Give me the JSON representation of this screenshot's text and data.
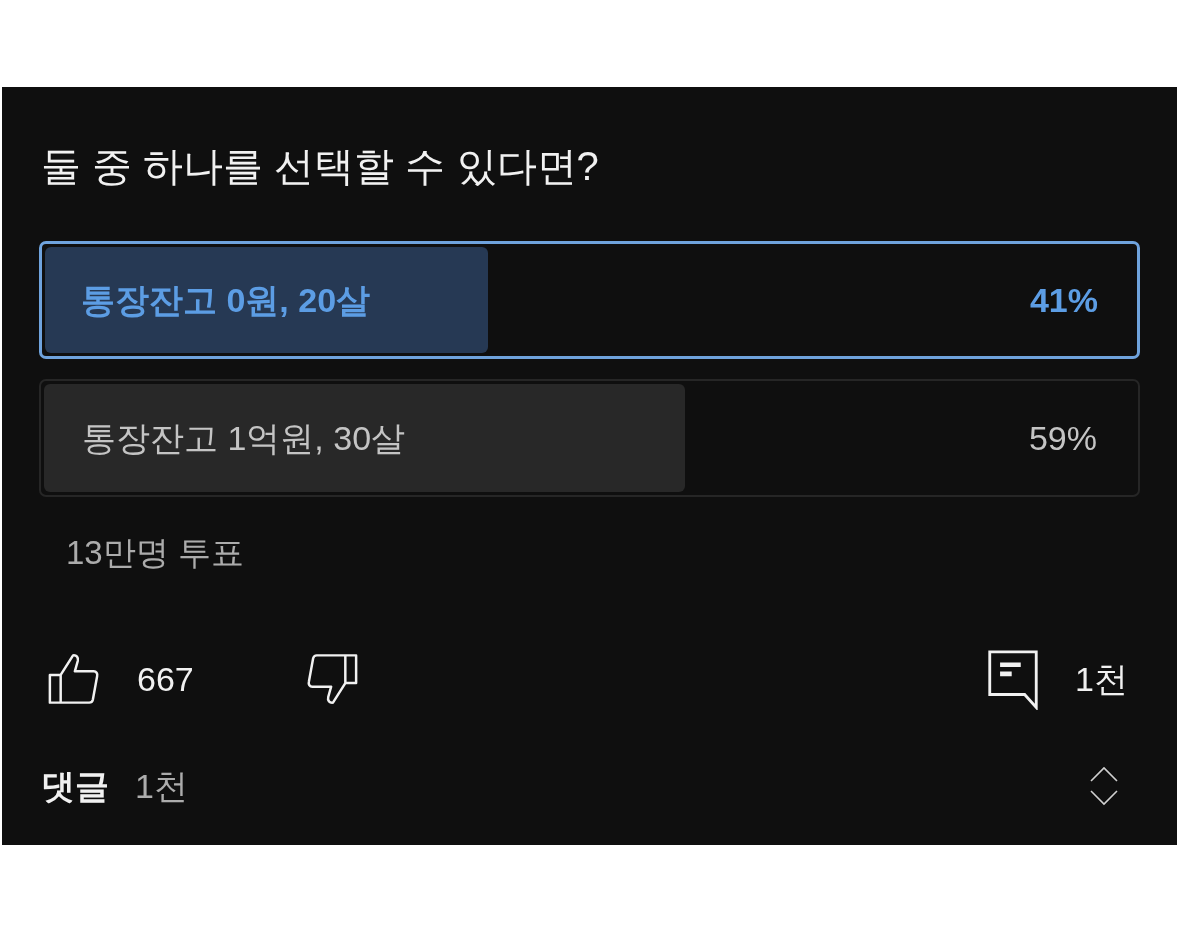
{
  "poll": {
    "question": "둘 중 하나를 선택할 수 있다면?",
    "options": [
      {
        "label": "통장잔고 0원, 20살",
        "percent": "41%",
        "level": 0.41,
        "selected": true
      },
      {
        "label": "통장잔고 1억원, 30살",
        "percent": "59%",
        "level": 0.59,
        "selected": false
      }
    ],
    "vote_count": "13만명 투표"
  },
  "actions": {
    "likes": "667",
    "comments": "1천"
  },
  "comments_header": {
    "label": "댓글",
    "count": "1천"
  }
}
